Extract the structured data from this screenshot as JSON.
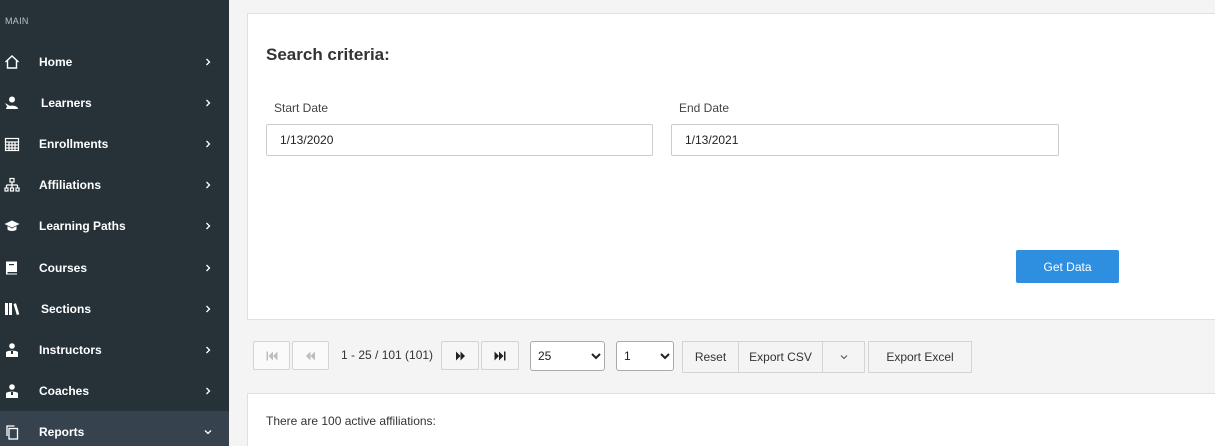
{
  "sidebar": {
    "section_label": "MAIN",
    "items": [
      {
        "label": "Home",
        "icon": "home-icon"
      },
      {
        "label": "Learners",
        "icon": "learner-icon"
      },
      {
        "label": "Enrollments",
        "icon": "calendar-icon"
      },
      {
        "label": "Affiliations",
        "icon": "org-chart-icon"
      },
      {
        "label": "Learning Paths",
        "icon": "graduation-cap-icon"
      },
      {
        "label": "Courses",
        "icon": "book-icon"
      },
      {
        "label": "Sections",
        "icon": "books-icon"
      },
      {
        "label": "Instructors",
        "icon": "instructor-icon"
      },
      {
        "label": "Coaches",
        "icon": "coach-icon"
      },
      {
        "label": "Reports",
        "icon": "copy-icon",
        "active": true
      }
    ],
    "colors": {
      "background": "#263238",
      "active": "#36434e"
    }
  },
  "search": {
    "heading": "Search criteria:",
    "start_label": "Start Date",
    "start_value": "1/13/2020",
    "end_label": "End Date",
    "end_value": "1/13/2021",
    "submit_label": "Get Data"
  },
  "toolbar": {
    "pager_text": "1 - 25 / 101 (101)",
    "page_size_options": [
      "25"
    ],
    "page_options": [
      "1"
    ],
    "reset_label": "Reset",
    "export_csv_label": "Export CSV",
    "export_excel_label": "Export Excel"
  },
  "results": {
    "summary": "There are 100 active affiliations:"
  },
  "colors": {
    "accent": "#2e8ee0"
  }
}
